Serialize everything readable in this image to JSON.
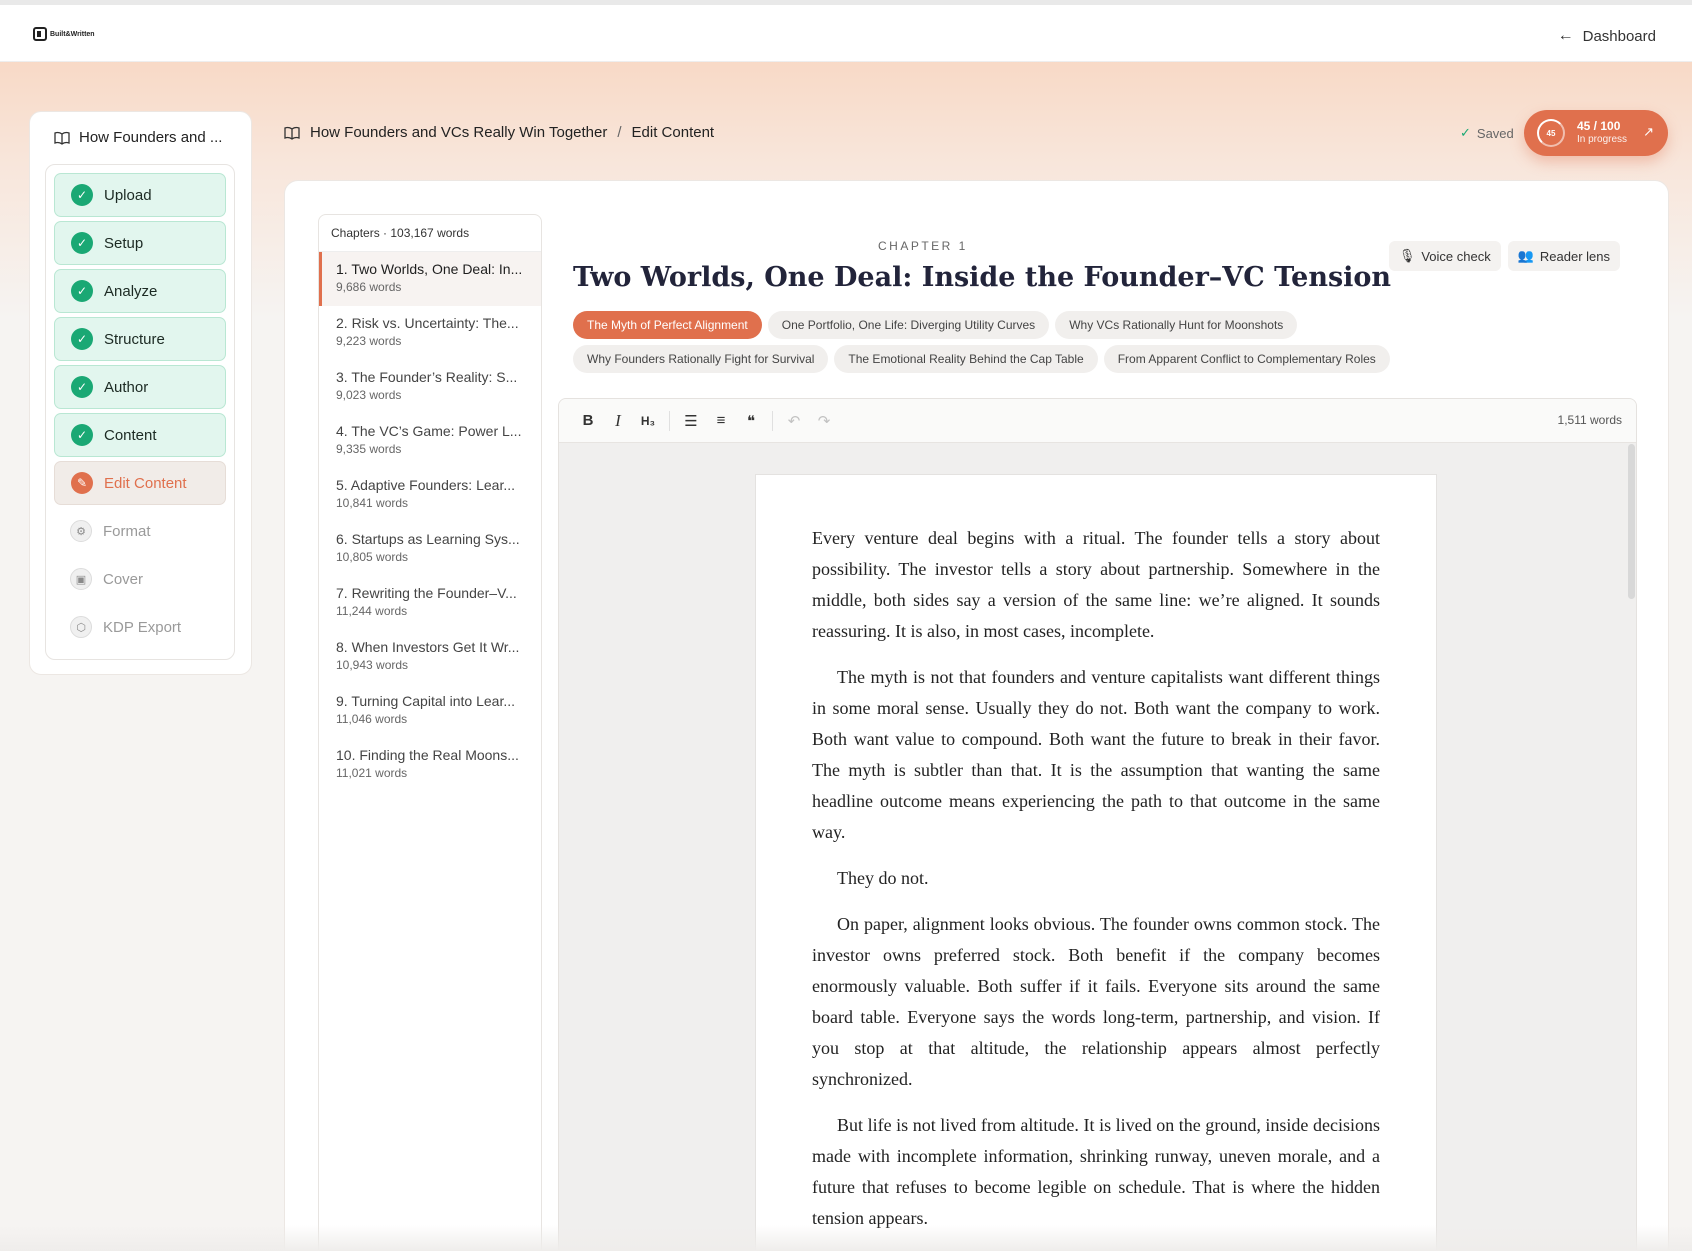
{
  "app": {
    "logo_text": "Built&Written",
    "dashboard_link": "Dashboard"
  },
  "sidebar": {
    "book_title": "How Founders and ...",
    "steps": [
      {
        "label": "Upload",
        "state": "done",
        "icon": "check-circle-icon"
      },
      {
        "label": "Setup",
        "state": "done",
        "icon": "check-circle-icon"
      },
      {
        "label": "Analyze",
        "state": "done",
        "icon": "check-circle-icon"
      },
      {
        "label": "Structure",
        "state": "done",
        "icon": "check-circle-icon"
      },
      {
        "label": "Author",
        "state": "done",
        "icon": "check-circle-icon"
      },
      {
        "label": "Content",
        "state": "done",
        "icon": "check-circle-icon"
      },
      {
        "label": "Edit Content",
        "state": "current",
        "icon": "edit-document-icon"
      },
      {
        "label": "Format",
        "state": "pending",
        "icon": "gear-icon"
      },
      {
        "label": "Cover",
        "state": "pending",
        "icon": "image-icon"
      },
      {
        "label": "KDP Export",
        "state": "pending",
        "icon": "package-icon"
      }
    ]
  },
  "breadcrumb": {
    "book": "How Founders and VCs Really Win Together",
    "separator": "/",
    "page": "Edit Content"
  },
  "status": {
    "saved": "Saved",
    "score_ring": "45",
    "score": "45 / 100",
    "score_status": "In progress",
    "score_value": 45,
    "accent": "#e0704d"
  },
  "chapters": {
    "header": "Chapters · 103,167 words",
    "items": [
      {
        "title": "1. Two Worlds, One Deal: In...",
        "words": "9,686 words"
      },
      {
        "title": "2. Risk vs. Uncertainty: The...",
        "words": "9,223 words"
      },
      {
        "title": "3. The Founder’s Reality: S...",
        "words": "9,023 words"
      },
      {
        "title": "4. The VC’s Game: Power L...",
        "words": "9,335 words"
      },
      {
        "title": "5. Adaptive Founders: Lear...",
        "words": "10,841 words"
      },
      {
        "title": "6. Startups as Learning Sys...",
        "words": "10,805 words"
      },
      {
        "title": "7. Rewriting the Founder–V...",
        "words": "11,244 words"
      },
      {
        "title": "8. When Investors Get It Wr...",
        "words": "10,943 words"
      },
      {
        "title": "9. Turning Capital into Lear...",
        "words": "11,046 words"
      },
      {
        "title": "10. Finding the Real Moons...",
        "words": "11,021 words"
      }
    ]
  },
  "chapter": {
    "label": "CHAPTER 1",
    "title": "Two Worlds, One Deal: Inside the Founder–VC Tension",
    "voice_check": "Voice check",
    "reader_lens": "Reader lens",
    "sections": [
      "The Myth of Perfect Alignment",
      "One Portfolio, One Life: Diverging Utility Curves",
      "Why VCs Rationally Hunt for Moonshots",
      "Why Founders Rationally Fight for Survival",
      "The Emotional Reality Behind the Cap Table",
      "From Apparent Conflict to Complementary Roles"
    ]
  },
  "editor": {
    "word_count": "1,511 words",
    "toolbar": {
      "bold": "B",
      "italic": "I",
      "heading": "H₃",
      "bullet": "☰",
      "numbered": "≡",
      "quote": "❝",
      "undo": "↶",
      "redo": "↷"
    },
    "paragraphs": [
      "Every venture deal begins with a ritual. The founder tells a story about possibility. The investor tells a story about partnership. Somewhere in the middle, both sides say a version of the same line: we’re aligned. It sounds reassuring. It is also, in most cases, incomplete.",
      "The myth is not that founders and venture capitalists want different things in some moral sense. Usually they do not. Both want the company to work. Both want value to compound. Both want the future to break in their favor. The myth is subtler than that. It is the assumption that wanting the same headline outcome means experiencing the path to that outcome in the same way.",
      "They do not.",
      "On paper, alignment looks obvious. The founder owns common stock. The investor owns preferred stock. Both benefit if the company becomes enormously valuable. Both suffer if it fails. Everyone sits around the same board table. Everyone says the words long-term, partnership, and vision. If you stop at that altitude, the relationship appears almost perfectly synchronized.",
      "But life is not lived from altitude. It is lived on the ground, inside decisions made with incomplete information, shrinking runway, uneven morale, and a future that refuses to become legible on schedule. That is where the hidden tension appears."
    ]
  }
}
